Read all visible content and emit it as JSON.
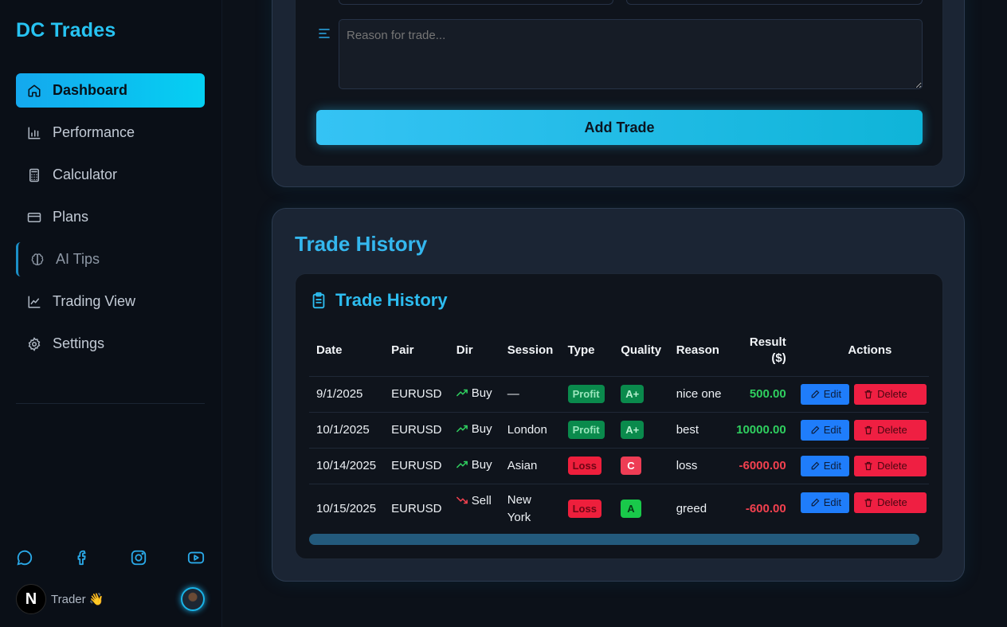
{
  "brand": "DC Trades",
  "nav": [
    {
      "label": "Dashboard",
      "icon": "home-icon"
    },
    {
      "label": "Performance",
      "icon": "bar-chart-icon"
    },
    {
      "label": "Calculator",
      "icon": "calculator-icon"
    },
    {
      "label": "Plans",
      "icon": "credit-card-icon"
    },
    {
      "label": "AI Tips",
      "icon": "brain-icon"
    },
    {
      "label": "Trading View",
      "icon": "line-chart-icon"
    },
    {
      "label": "Settings",
      "icon": "gear-icon"
    }
  ],
  "socials": [
    "chat-icon",
    "facebook-icon",
    "instagram-icon",
    "youtube-icon"
  ],
  "user": {
    "logo": "N",
    "name": "Trader 👋"
  },
  "form": {
    "reason_placeholder": "Reason for trade...",
    "add_button": "Add Trade"
  },
  "history": {
    "section_title": "Trade History",
    "card_title": "Trade History",
    "columns": [
      "Date",
      "Pair",
      "Dir",
      "Session",
      "Type",
      "Quality",
      "Reason",
      "Result ($)",
      "Actions"
    ],
    "rows": [
      {
        "date": "9/1/2025",
        "pair": "EURUSD",
        "dir": "Buy",
        "session": "—",
        "type": "Profit",
        "quality": "A+",
        "reason": "nice one",
        "result": "500.00",
        "edit": "Edit",
        "delete": "Delete"
      },
      {
        "date": "10/1/2025",
        "pair": "EURUSD",
        "dir": "Buy",
        "session": "London",
        "type": "Profit",
        "quality": "A+",
        "reason": "best",
        "result": "10000.00",
        "edit": "Edit",
        "delete": "Delete"
      },
      {
        "date": "10/14/2025",
        "pair": "EURUSD",
        "dir": "Buy",
        "session": "Asian",
        "type": "Loss",
        "quality": "C",
        "reason": "loss",
        "result": "-6000.00",
        "edit": "Edit",
        "delete": "Delete"
      },
      {
        "date": "10/15/2025",
        "pair": "EURUSD",
        "dir": "Sell",
        "session": "New York",
        "type": "Loss",
        "quality": "A",
        "reason": "greed",
        "result": "-600.00",
        "edit": "Edit",
        "delete": "Delete"
      }
    ]
  },
  "colors": {
    "accent": "#27c3f2",
    "profit": "#2fcf5f",
    "loss": "#f2414f"
  }
}
